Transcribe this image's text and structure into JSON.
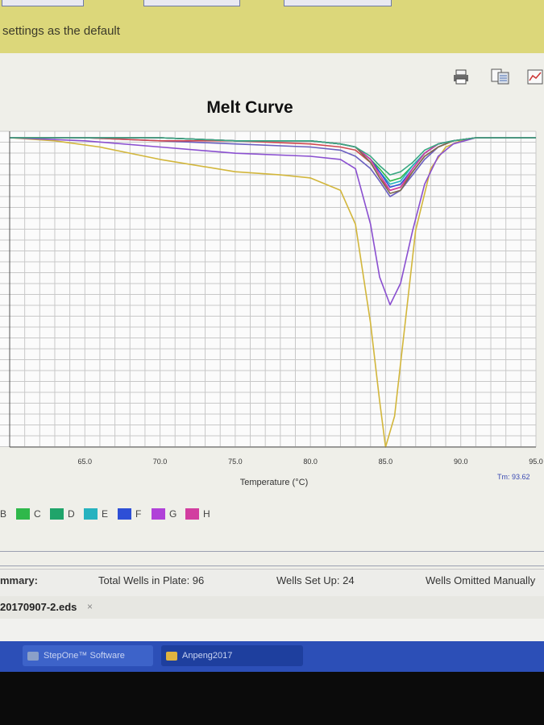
{
  "top_bar": {
    "settings_text": "settings as the default"
  },
  "toolbar": {
    "icons": [
      "print-icon",
      "export-icon",
      "chart-settings-icon"
    ]
  },
  "chart": {
    "title": "Melt Curve",
    "xlabel": "Temperature (°C)",
    "x_ticks": [
      "65.0",
      "70.0",
      "75.0",
      "80.0",
      "85.0",
      "90.0",
      "95.0"
    ],
    "tm_text": "Tm: 93.62"
  },
  "chart_data": {
    "type": "line",
    "title": "Melt Curve",
    "xlabel": "Temperature (°C)",
    "ylabel": "",
    "xlim": [
      60,
      95
    ],
    "ylim": [
      -100,
      2
    ],
    "grid": true,
    "series": [
      {
        "color": "#d2b63b",
        "x": [
          60,
          63,
          66,
          70,
          75,
          78,
          80,
          82,
          83,
          84,
          84.6,
          85.0,
          85.6,
          86.3,
          87.0,
          88.0,
          89,
          90,
          91,
          95
        ],
        "y": [
          0,
          -1,
          -3,
          -7,
          -11,
          -12,
          -13,
          -17,
          -28,
          -60,
          -85,
          -100,
          -90,
          -60,
          -30,
          -10,
          -3,
          -1,
          0,
          0
        ]
      },
      {
        "color": "#8a4fd0",
        "x": [
          60,
          65,
          70,
          75,
          80,
          82,
          83,
          84,
          84.6,
          85.3,
          86,
          86.8,
          87.6,
          88.5,
          89.5,
          91,
          95
        ],
        "y": [
          0,
          -1,
          -3,
          -5,
          -6,
          -7,
          -10,
          -28,
          -45,
          -54,
          -47,
          -30,
          -15,
          -6,
          -2,
          0,
          0
        ]
      },
      {
        "color": "#6a5fc0",
        "x": [
          60,
          65,
          70,
          75,
          80,
          82,
          83,
          84,
          84.6,
          85.3,
          86,
          86.8,
          87.6,
          88.5,
          89.5,
          91,
          95
        ],
        "y": [
          0,
          0,
          -1,
          -2,
          -3,
          -4,
          -6,
          -10,
          -14,
          -19,
          -17,
          -12,
          -7,
          -3,
          -1,
          0,
          0
        ]
      },
      {
        "color": "#d0484f",
        "x": [
          60,
          65,
          70,
          75,
          80,
          82,
          83,
          84,
          84.6,
          85.3,
          86,
          86.8,
          87.6,
          88.5,
          89.5,
          91,
          95
        ],
        "y": [
          0,
          0,
          -1,
          -1,
          -2,
          -3,
          -4,
          -8,
          -13,
          -17,
          -16,
          -11,
          -6,
          -3,
          -1,
          0,
          0
        ]
      },
      {
        "color": "#2fb84a",
        "x": [
          60,
          65,
          70,
          75,
          80,
          82,
          83,
          84,
          84.6,
          85.3,
          86,
          86.8,
          87.6,
          88.5,
          89.5,
          91,
          95
        ],
        "y": [
          0,
          0,
          0,
          -1,
          -1,
          -2,
          -3,
          -7,
          -10,
          -14,
          -13,
          -9,
          -5,
          -2,
          -1,
          0,
          0
        ]
      },
      {
        "color": "#26b2bf",
        "x": [
          60,
          65,
          70,
          75,
          80,
          82,
          83,
          84,
          84.6,
          85.3,
          86,
          86.8,
          87.6,
          88.5,
          89.5,
          91,
          95
        ],
        "y": [
          0,
          0,
          0,
          -1,
          -1,
          -2,
          -3,
          -7,
          -11,
          -15,
          -14,
          -9,
          -5,
          -2,
          -1,
          0,
          0
        ]
      },
      {
        "color": "#2e4fd6",
        "x": [
          60,
          65,
          70,
          75,
          80,
          82,
          83,
          84,
          84.6,
          85.3,
          86,
          86.8,
          87.6,
          88.5,
          89.5,
          91,
          95
        ],
        "y": [
          0,
          0,
          0,
          -1,
          -1,
          -2,
          -3,
          -7,
          -11,
          -16,
          -15,
          -10,
          -5,
          -2,
          -1,
          0,
          0
        ]
      },
      {
        "color": "#d23ea0",
        "x": [
          60,
          65,
          70,
          75,
          80,
          82,
          83,
          84,
          84.6,
          85.3,
          86,
          86.8,
          87.6,
          88.5,
          89.5,
          91,
          95
        ],
        "y": [
          0,
          0,
          0,
          -1,
          -1,
          -2,
          -3,
          -7,
          -12,
          -17,
          -16,
          -10,
          -5,
          -2,
          -1,
          0,
          0
        ]
      },
      {
        "color": "#7a6b4f",
        "x": [
          60,
          65,
          70,
          75,
          80,
          82,
          83,
          84,
          84.6,
          85.3,
          86,
          86.8,
          87.6,
          88.5,
          89.5,
          91,
          95
        ],
        "y": [
          0,
          0,
          0,
          -1,
          -1,
          -2,
          -3,
          -8,
          -13,
          -18,
          -17,
          -11,
          -6,
          -3,
          -1,
          0,
          0
        ]
      },
      {
        "color": "#3aa882",
        "x": [
          60,
          65,
          70,
          75,
          80,
          82,
          83,
          84,
          84.6,
          85.3,
          86,
          86.8,
          87.6,
          88.5,
          89.5,
          91,
          95
        ],
        "y": [
          0,
          0,
          0,
          -1,
          -1,
          -2,
          -3,
          -6,
          -9,
          -12,
          -11,
          -8,
          -4,
          -2,
          -1,
          0,
          0
        ]
      }
    ]
  },
  "legend": [
    {
      "label": "B",
      "color": null
    },
    {
      "label": "C",
      "color": "#2fb84a"
    },
    {
      "label": "D",
      "color": "#1fa46a"
    },
    {
      "label": "E",
      "color": "#26b2bf"
    },
    {
      "label": "F",
      "color": "#2e4fd6"
    },
    {
      "label": "G",
      "color": "#b041d8"
    },
    {
      "label": "H",
      "color": "#d23ea0"
    }
  ],
  "summary": {
    "label": "mmary:",
    "total_wells": "Total Wells in Plate: 96",
    "wells_set_up": "Wells Set Up: 24",
    "wells_omitted": "Wells Omitted Manually"
  },
  "file_tab": {
    "name": "20170907-2.eds",
    "close": "×"
  },
  "taskbar": [
    {
      "name": "task-stepone",
      "label": "StepOne™ Software",
      "icon_color": "#8ba0c8"
    },
    {
      "name": "task-folder",
      "label": "Anpeng2017",
      "icon_color": "#e0b440"
    }
  ]
}
